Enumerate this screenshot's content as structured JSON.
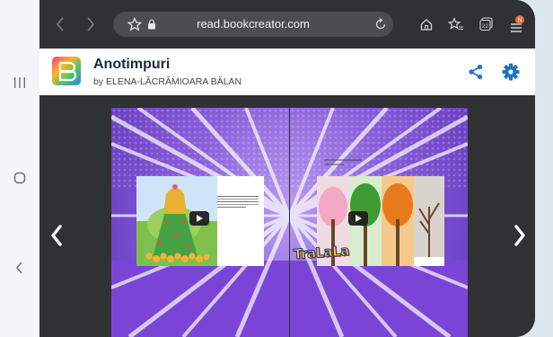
{
  "browser": {
    "url": "read.bookcreator.com",
    "tab_count": "22",
    "notification_badge": "N"
  },
  "book": {
    "title": "Anotimpuri",
    "author": "by ELENA-LĂCRĂMIOARA BĂLAN"
  },
  "pages": {
    "right_logo_text": "TraLaLa"
  },
  "colors": {
    "accent": "#1a73c9",
    "page_purple": "#7a4fd0"
  },
  "icons": {
    "back": "chevron-left-icon",
    "forward": "chevron-right-icon",
    "star": "star-outline-icon",
    "lock": "lock-icon",
    "reload": "reload-icon",
    "home": "home-icon",
    "favorites": "star-list-icon",
    "tabs": "tabs-icon",
    "menu": "menu-icon",
    "share": "share-icon",
    "settings": "gear-icon",
    "play": "play-icon"
  }
}
